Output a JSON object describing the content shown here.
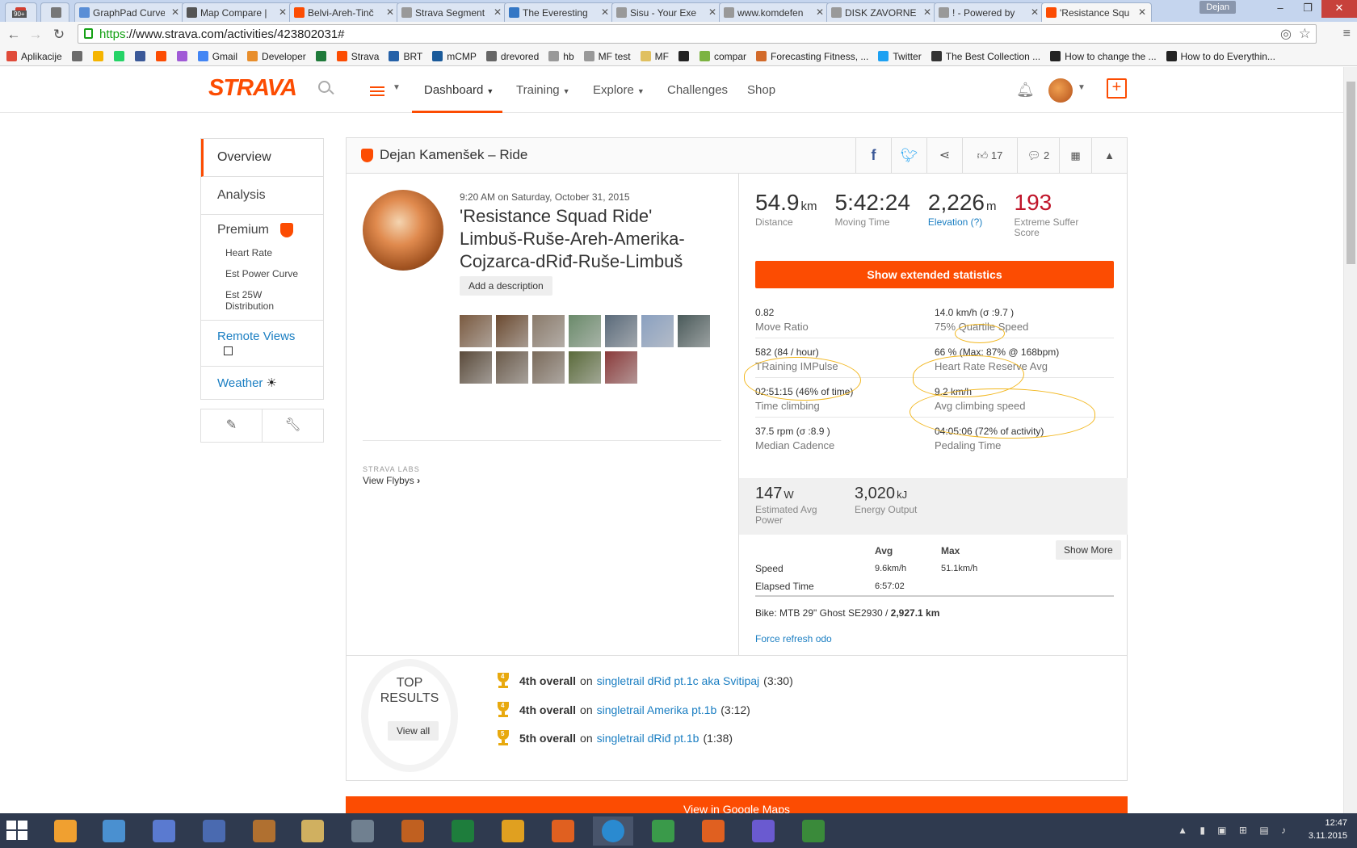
{
  "browser": {
    "tabs": [
      {
        "title": "",
        "color": "#d23f31"
      },
      {
        "title": "",
        "color": "#777"
      },
      {
        "title": "GraphPad Curve",
        "color": "#5a8ed6"
      },
      {
        "title": "Map Compare |",
        "color": "#555"
      },
      {
        "title": "Belvi-Areh-Tinč",
        "color": "#fc4c02"
      },
      {
        "title": "Strava Segment",
        "color": "#999"
      },
      {
        "title": "The Everesting",
        "color": "#3477c5"
      },
      {
        "title": "Sisu - Your Exe",
        "color": "#999"
      },
      {
        "title": "www.komdefen",
        "color": "#999"
      },
      {
        "title": "DISK ZAVORNE",
        "color": "#999"
      },
      {
        "title": "! - Powered by",
        "color": "#999"
      },
      {
        "title": "'Resistance Squ",
        "color": "#fc4c02"
      }
    ],
    "gmail_badge": "90+",
    "user": "Dejan",
    "url_https": "https",
    "url_rest": "://www.strava.com/activities/423802031#",
    "bookmarks": [
      {
        "label": "Aplikacije",
        "color": "#e04b3a"
      },
      {
        "label": "",
        "color": "#6b6b6b"
      },
      {
        "label": "",
        "color": "#f5b400"
      },
      {
        "label": "",
        "color": "#25d366"
      },
      {
        "label": "",
        "color": "#3b5998"
      },
      {
        "label": "",
        "color": "#fc4c02"
      },
      {
        "label": "",
        "color": "#a05ad6"
      },
      {
        "label": "Gmail",
        "color": "#4285f4"
      },
      {
        "label": "Developer",
        "color": "#e88e2c"
      },
      {
        "label": "",
        "color": "#1f7a3a"
      },
      {
        "label": "Strava",
        "color": "#fc4c02"
      },
      {
        "label": "BRT",
        "color": "#2561a8"
      },
      {
        "label": "mCMP",
        "color": "#1a5a9a"
      },
      {
        "label": "drevored",
        "color": "#666"
      },
      {
        "label": "hb",
        "color": "#999"
      },
      {
        "label": "MF test",
        "color": "#999"
      },
      {
        "label": "MF",
        "color": "#e0c060"
      },
      {
        "label": "",
        "color": "#222"
      },
      {
        "label": "compar",
        "color": "#7cb342"
      },
      {
        "label": "Forecasting Fitness, ...",
        "color": "#d26a2a"
      },
      {
        "label": "Twitter",
        "color": "#1da1f2"
      },
      {
        "label": "The Best Collection ...",
        "color": "#333"
      },
      {
        "label": "How to change the ...",
        "color": "#222"
      },
      {
        "label": "How to do Everythin...",
        "color": "#222"
      }
    ]
  },
  "nav": {
    "logo": "STRAVA",
    "dashboard": "Dashboard",
    "training": "Training",
    "explore": "Explore",
    "challenges": "Challenges",
    "shop": "Shop"
  },
  "sidebar": {
    "overview": "Overview",
    "analysis": "Analysis",
    "premium": "Premium",
    "premium_items": [
      "Heart Rate",
      "Est Power Curve",
      "Est 25W Distribution"
    ],
    "remote_views": "Remote Views",
    "weather": "Weather"
  },
  "activity": {
    "header": "Dejan Kamenšek – Ride",
    "kudos": "17",
    "comments": "2",
    "date": "9:20 AM on Saturday, October 31, 2015",
    "name": "'Resistance Squad Ride' Limbuš-Ruše-Areh-Amerika-Cojzarca-dRiđ-Ruše-Limbuš",
    "add_description": "Add a description",
    "photo_colors": [
      "#7a5a40",
      "#6b4a30",
      "#8a7a6a",
      "#6a8a6a",
      "#5a6a7a",
      "#8aa0c0",
      "#4a5a5a",
      "#5a4a3a",
      "#6a5a4a",
      "#7a6a5a",
      "#5a6a3a",
      "#8a3a3a"
    ],
    "labs": "STRAVA LABS",
    "flybys": "View Flybys"
  },
  "stats": {
    "distance_value": "54.9",
    "distance_unit": "km",
    "distance_label": "Distance",
    "moving_time_value": "5:42:24",
    "moving_time_label": "Moving Time",
    "elevation_value": "2,226",
    "elevation_unit": "m",
    "elevation_label": "Elevation (?)",
    "suffer_value": "193",
    "suffer_label": "Extreme Suffer Score",
    "extended_button": "Show extended statistics",
    "grid": [
      [
        {
          "value": "0.82",
          "extra": "",
          "label": "Move Ratio"
        },
        {
          "value": "14.0 km/h",
          "extra": " (σ :9.7 )",
          "label": "75% Quartile Speed"
        }
      ],
      [
        {
          "value": "582",
          "extra": " (84 / hour)",
          "label": "TRaining IMPulse"
        },
        {
          "value": "66 %",
          "extra": " (Max: 87% @ 168bpm)",
          "label": "Heart Rate Reserve Avg"
        }
      ],
      [
        {
          "value": "02:51:15",
          "extra": " (46% of time)",
          "label": "Time climbing"
        },
        {
          "value": "9.2 km/h",
          "extra": "",
          "label": "Avg climbing speed"
        }
      ],
      [
        {
          "value": "37.5 rpm",
          "extra": " (σ :8.9 )",
          "label": "Median Cadence"
        },
        {
          "value": "04:05:06",
          "extra": " (72% of activity)",
          "label": "Pedaling Time"
        }
      ]
    ],
    "power_value": "147",
    "power_unit": "W",
    "power_label": "Estimated Avg Power",
    "energy_value": "3,020",
    "energy_unit": "kJ",
    "energy_label": "Energy Output",
    "table_avg": "Avg",
    "table_max": "Max",
    "show_more": "Show More",
    "speed_label": "Speed",
    "speed_avg": "9.6km/h",
    "speed_max": "51.1km/h",
    "elapsed_label": "Elapsed Time",
    "elapsed_avg": "6:57:02",
    "bike_prefix": "Bike: MTB 29\" Ghost SE2930 / ",
    "bike_odo": "2,927.1 km",
    "force_refresh": "Force refresh odo"
  },
  "top_results": {
    "title": "TOP RESULTS",
    "view_all": "View all",
    "items": [
      {
        "rank": "4th overall",
        "on": "on",
        "segment": "singletrail dRiđ pt.1c aka Svitipaj",
        "time": "(3:30)",
        "badge": "4"
      },
      {
        "rank": "4th overall",
        "on": "on",
        "segment": "singletrail Amerika pt.1b",
        "time": "(3:12)",
        "badge": "4"
      },
      {
        "rank": "5th overall",
        "on": "on",
        "segment": "singletrail dRiđ pt.1b",
        "time": "(1:38)",
        "badge": "5"
      }
    ]
  },
  "maps_button": "View in Google Maps",
  "clock": {
    "time": "12:47",
    "date": "3.11.2015"
  },
  "taskbar_colors": [
    "#f0a030",
    "#4a90d0",
    "#5a7ad0",
    "#4a6ab0",
    "#b07030",
    "#d0b060",
    "#708090",
    "#c06020",
    "#1e7d3c",
    "#e0a020",
    "#e06020",
    "#2a8ad0",
    "#3a9a4a",
    "#e06020",
    "#6a5ad0",
    "#3a8a3a"
  ]
}
